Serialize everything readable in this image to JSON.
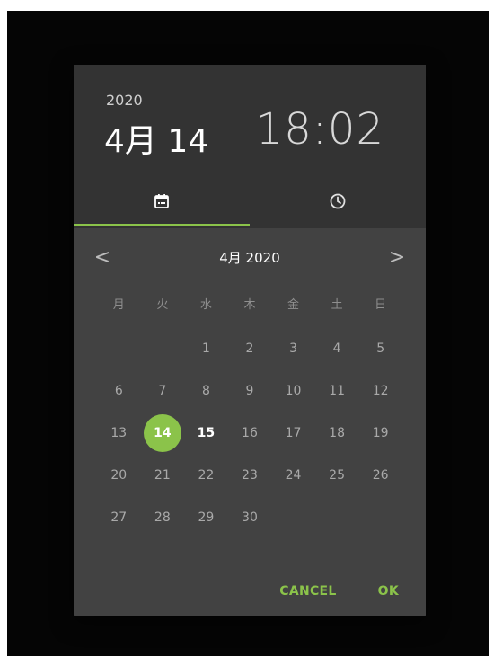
{
  "header": {
    "year": "2020",
    "date": "4月 14",
    "time": "18:02"
  },
  "tabs": [
    {
      "icon": "calendar-icon",
      "active": true
    },
    {
      "icon": "clock-icon",
      "active": false
    }
  ],
  "calendar": {
    "month_label": "4月 2020",
    "prev_icon": "<",
    "next_icon": ">",
    "weekdays": [
      "月",
      "火",
      "水",
      "木",
      "金",
      "土",
      "日"
    ],
    "leading_blanks": 2,
    "days": [
      "1",
      "2",
      "3",
      "4",
      "5",
      "6",
      "7",
      "8",
      "9",
      "10",
      "11",
      "12",
      "13",
      "14",
      "15",
      "16",
      "17",
      "18",
      "19",
      "20",
      "21",
      "22",
      "23",
      "24",
      "25",
      "26",
      "27",
      "28",
      "29",
      "30"
    ],
    "selected_day": "14",
    "today": "15"
  },
  "actions": {
    "cancel_label": "CANCEL",
    "ok_label": "OK"
  },
  "colors": {
    "accent": "#8bc34a",
    "dialog_bg": "#424242",
    "header_bg": "#333333"
  }
}
